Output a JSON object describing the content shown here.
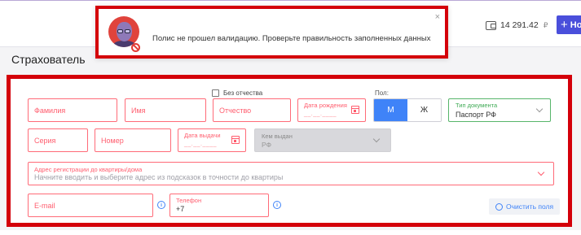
{
  "header": {
    "balance": "14 291.42",
    "currency": "₽",
    "new_button_label": "Но"
  },
  "notification": {
    "message": "Полис не прошел валидацию. Проверьте правильность заполненных данных",
    "close": "×"
  },
  "section": {
    "title": "Страхователь"
  },
  "form": {
    "no_patronymic_label": "Без отчества",
    "last_name": "Фамилия",
    "first_name": "Имя",
    "patronymic": "Отчество",
    "birth_date_label": "Дата рождения",
    "birth_date_mask": "__.__.____",
    "gender_label": "Пол:",
    "gender_male": "М",
    "gender_female": "Ж",
    "doc_type_label": "Тип документа",
    "doc_type_value": "Паспорт РФ",
    "series": "Серия",
    "number": "Номер",
    "issue_date_label": "Дата выдачи",
    "issue_date_mask": "__.__.____",
    "issued_by_label": "Кем выдан",
    "issued_by_value": "РФ",
    "address_label": "Адрес регистрации до квартиры/дома",
    "address_placeholder": "Начните вводить и выберите адрес из подсказок в точности до квартиры",
    "email": "E-mail",
    "phone_label": "Телефон",
    "phone_value": "+7",
    "info_glyph": "i",
    "clear_button": "Очистить поля"
  },
  "colors": {
    "error_border": "#ff6b78",
    "highlight_red": "#d4000a",
    "primary_blue": "#3f83f8",
    "valid_green": "#57b56a",
    "button_purple": "#4a4fdb"
  }
}
